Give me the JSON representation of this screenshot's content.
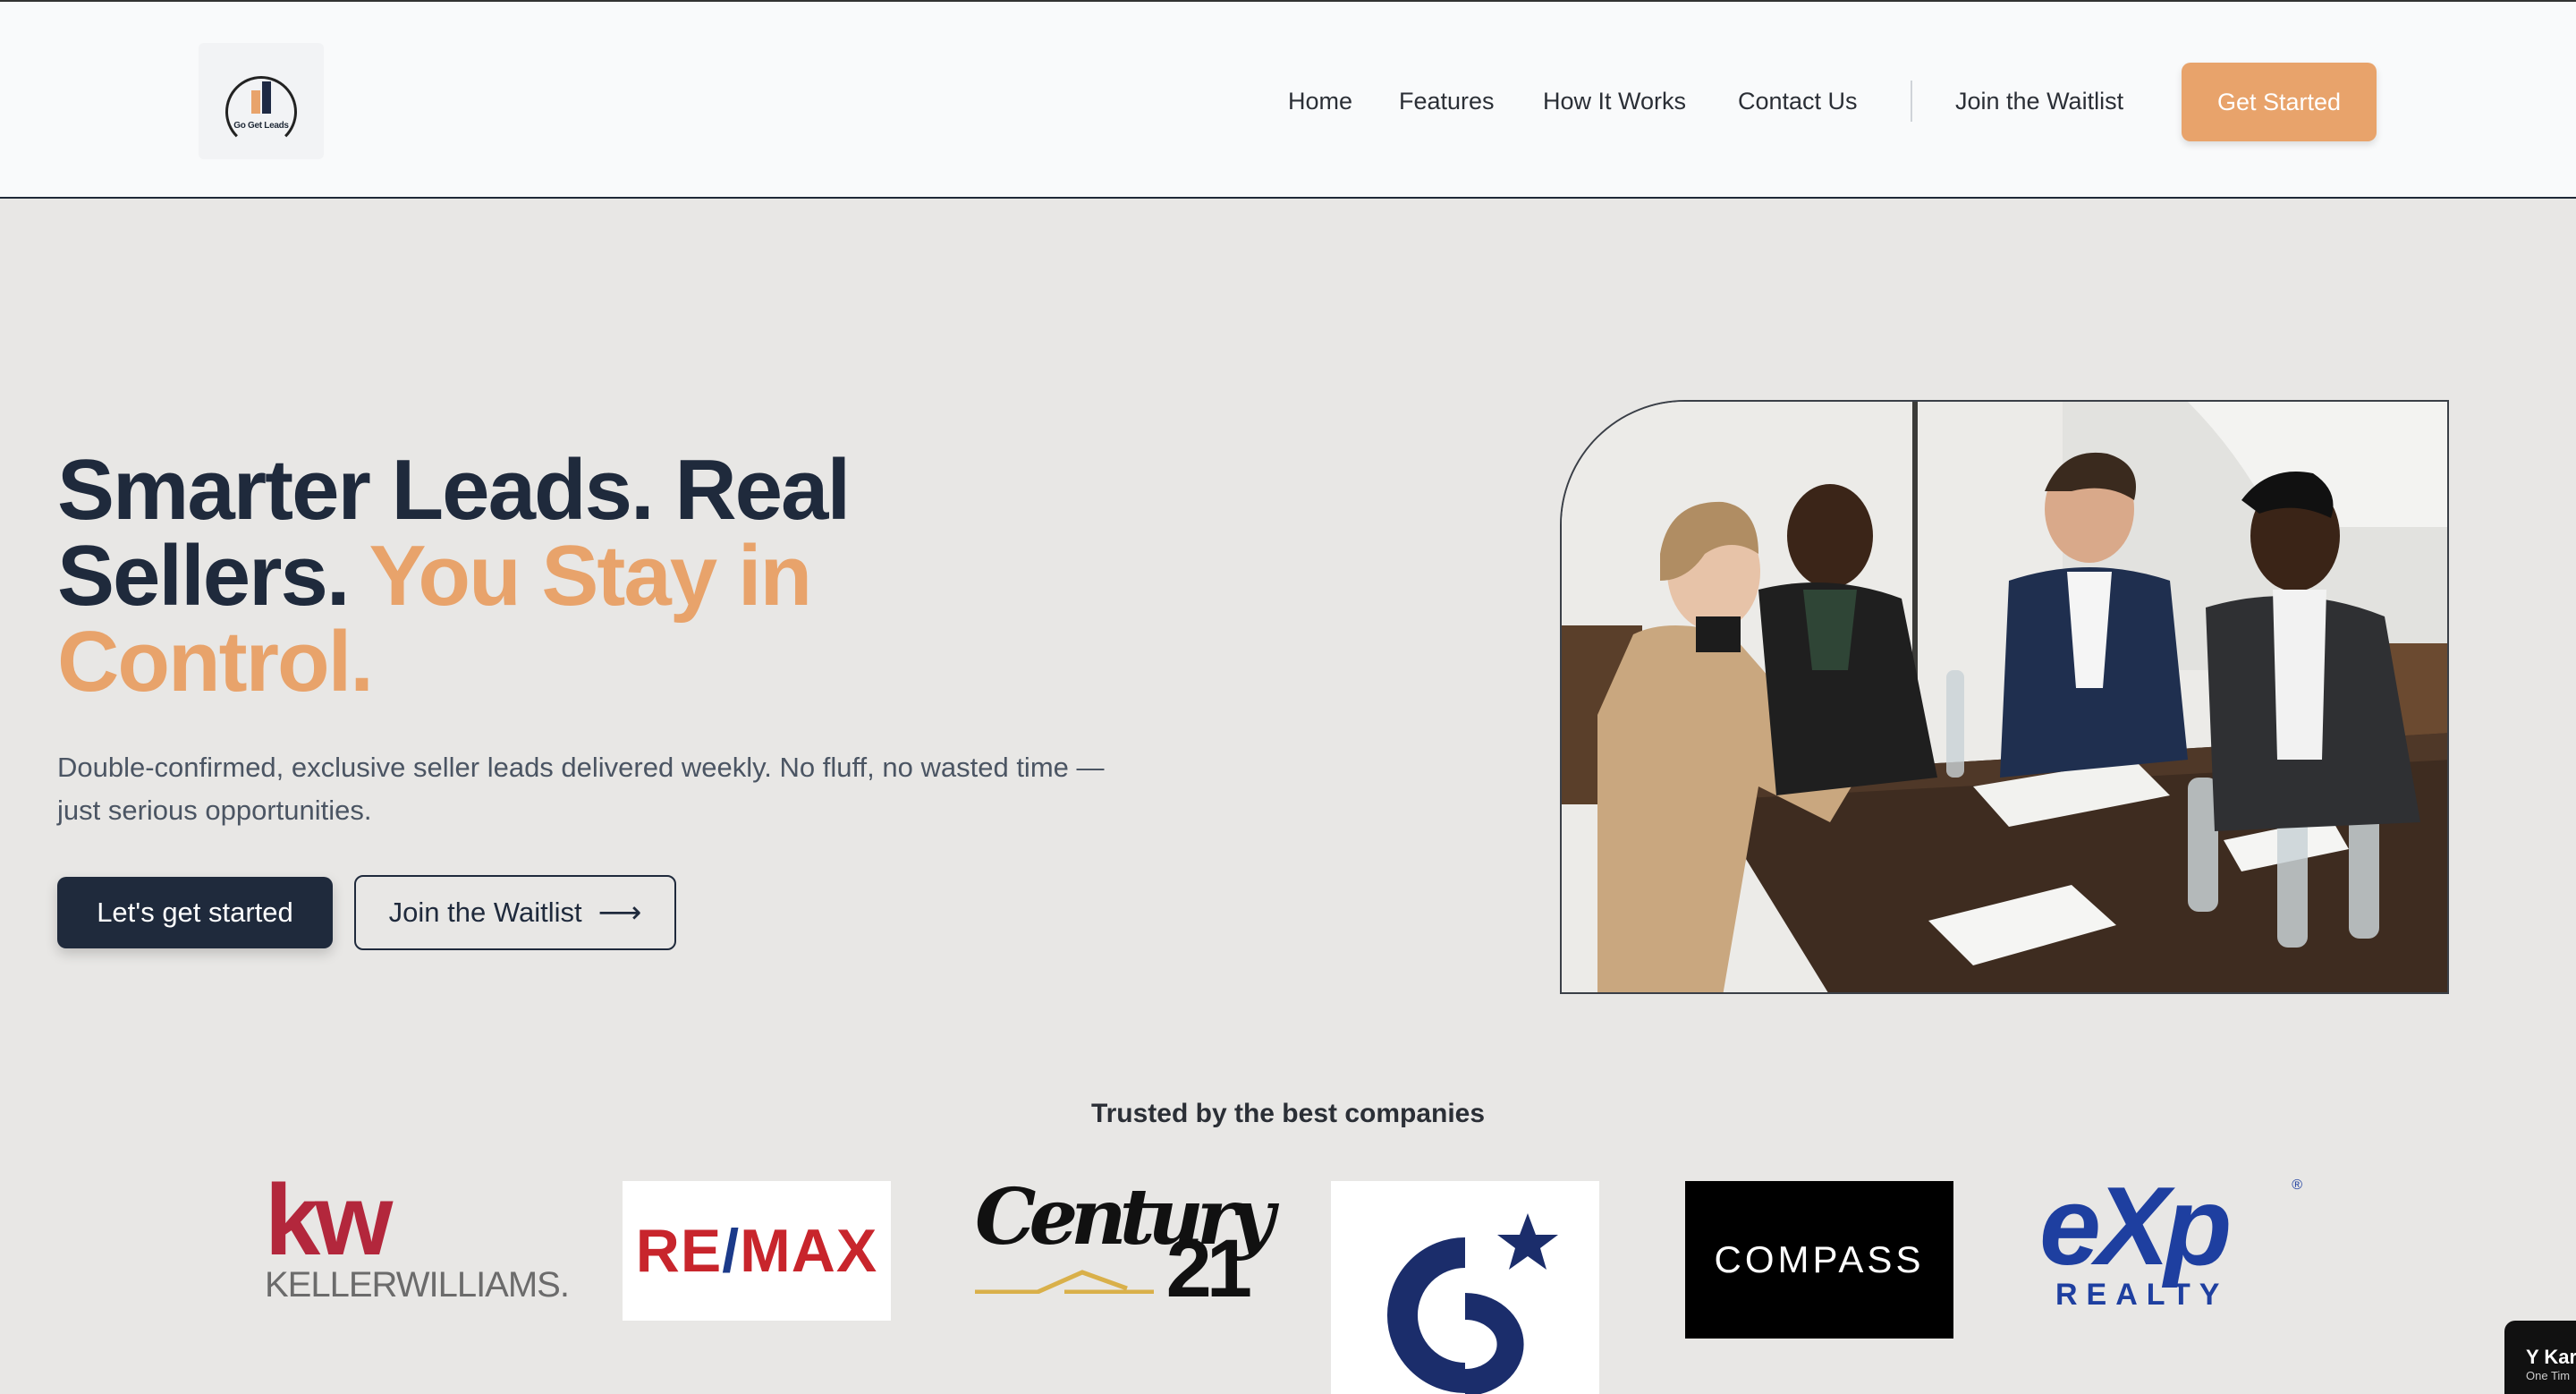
{
  "header": {
    "logo_text": "Go Get Leads",
    "nav": [
      "Home",
      "Features",
      "How It Works",
      "Contact Us"
    ],
    "join_waitlist": "Join the Waitlist",
    "get_started": "Get Started"
  },
  "hero": {
    "title_part1": "Smarter Leads. Real Sellers. ",
    "title_accent": "You Stay in Control.",
    "subtitle": "Double-confirmed, exclusive seller leads delivered weekly. No fluff, no wasted time — just serious opportunities.",
    "primary_cta": "Let's get started",
    "secondary_cta": "Join the Waitlist",
    "arrow": "⟶"
  },
  "trusted": {
    "heading": "Trusted by the best companies",
    "kw_letters": "kw",
    "kw_name_a": "KELLER",
    "kw_name_b": "WILLIAMS.",
    "remax_a": "RE",
    "remax_slash": "/",
    "remax_b": "MAX",
    "c21_word": "Century",
    "c21_num": "21",
    "compass": "COMPASS",
    "exp_word": "eXp",
    "exp_realty": "REALTY",
    "exp_reg": "®"
  },
  "widget": {
    "title": "Y Kar",
    "sub": "One Tim"
  },
  "colors": {
    "accent": "#e8a36b",
    "navy": "#1f2a3c",
    "background": "#e8e7e5"
  }
}
